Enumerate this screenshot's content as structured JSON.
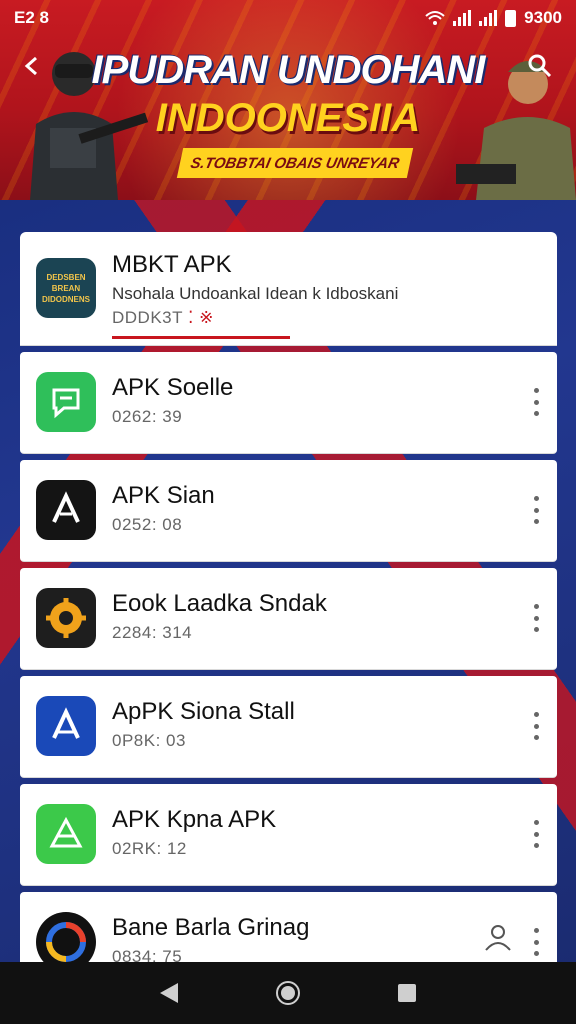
{
  "status": {
    "left": "E2 8",
    "right": "9300"
  },
  "banner": {
    "title": "IPUDRAN UNDOHANI",
    "subtitle": "INDOONESIIA",
    "tagline": "S.TOBBTAI OBAIS UNREYAR"
  },
  "featured": {
    "icon_text": "DEDSBEN BREAN DIDODNENS",
    "title": "MBKT APK",
    "description": "Nsohala Undoankal Idean k Idboskani",
    "meta": "DDDK3T",
    "meta_highlight": "⁚ ※"
  },
  "items": [
    {
      "title": "APK Soelle",
      "meta": "0262: 39",
      "icon": "chat-bubble-icon"
    },
    {
      "title": "APK Sian",
      "meta": "0252: 08",
      "icon": "apk-a-logo-icon"
    },
    {
      "title": "Eook Laadka Sndak",
      "meta": "2284: 314",
      "icon": "gear-badge-icon"
    },
    {
      "title": "ApPK Siona Stall",
      "meta": "0P8K: 03",
      "icon": "apk-blue-logo-icon"
    },
    {
      "title": "APK Kpna APK",
      "meta": "02RK: 12",
      "icon": "green-triangle-logo-icon"
    },
    {
      "title": "Bane Barla Grinag",
      "meta": "0834: 75",
      "icon": "color-ring-logo-icon"
    }
  ],
  "colors": {
    "accent_red": "#c8161e",
    "banner_yellow": "#ffd21f",
    "background_blue": "#1b2a6b"
  }
}
